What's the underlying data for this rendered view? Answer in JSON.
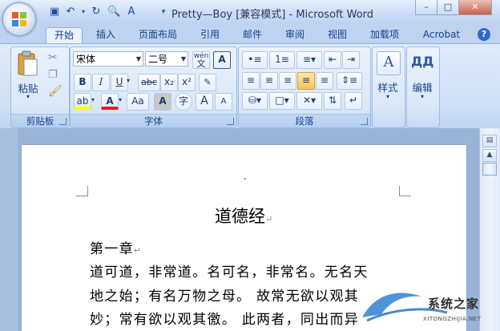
{
  "window": {
    "title": "Pretty—Boy [兼容模式] - Microsoft Word",
    "minimize": "–",
    "restore": "□",
    "close": "✕"
  },
  "tabs": [
    "开始",
    "插入",
    "页面布局",
    "引用",
    "邮件",
    "审阅",
    "视图",
    "加载项",
    "Acrobat"
  ],
  "help": "?",
  "clipboard": {
    "paste": "粘贴",
    "group": "剪贴板"
  },
  "font": {
    "name": "宋体",
    "size": "二号",
    "phonetic": "wén",
    "bold": "B",
    "italic": "I",
    "underline": "U",
    "strike": "abc",
    "subscript": "x₂",
    "superscript": "x²",
    "change_case": "Aa",
    "grow": "A",
    "shrink": "A",
    "group": "字体"
  },
  "paragraph": {
    "group": "段落"
  },
  "styles": {
    "label": "样式"
  },
  "editing": {
    "label": "编辑"
  },
  "document": {
    "heading": "道德经",
    "lines": [
      "第一章",
      "道可道，非常道。名可名，非常名。无名天",
      "地之始；有名万物之母。 故常无欲以观其",
      "妙；常有欲以观其徼。 此两者，同出而异"
    ]
  },
  "watermark": {
    "brand": "系统之家",
    "url": "XITONGZHIJIA.NET"
  },
  "colors": {
    "accent": "#15428b",
    "highlight": "#f7c25a",
    "font_color_red": "#e02020"
  }
}
